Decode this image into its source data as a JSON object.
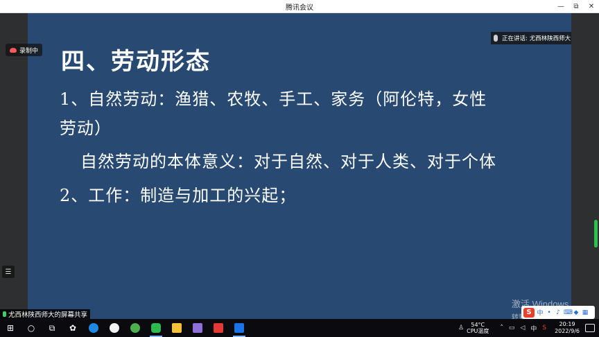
{
  "window": {
    "title": "腾讯会议"
  },
  "window_controls": {
    "minimize": "—",
    "restore": "⧉",
    "close": "✕"
  },
  "recording": {
    "label": "录制中"
  },
  "speaker": {
    "label": "正在讲话: 尤西林陕西师大"
  },
  "slide": {
    "title": "四、劳动形态",
    "line1": "1、自然劳动：渔猎、农牧、手工、家务（阿伦特，女性",
    "line2": "劳动）",
    "line3": "自然劳动的本体意义：对于自然、对于人类、对于个体",
    "line4": "2、工作：制造与加工的兴起；"
  },
  "watermark": {
    "line1": "激活 Windows",
    "line2": "转到\"设置\"以激活 Windows。"
  },
  "share": {
    "label": "尤西林陕西师大的屏幕共享"
  },
  "taskbar": {
    "temperature": "54°C",
    "temperature_label": "CPU温度",
    "lang": "中",
    "time": "20:19",
    "date": "2022/9/6"
  },
  "ime": {
    "logo": "S",
    "mode": "中"
  },
  "colors": {
    "slide_bg": "#284a72",
    "title_bar": "#ffffff",
    "taskbar": "#0b0b0f",
    "scroll": "#2fbf4a"
  }
}
